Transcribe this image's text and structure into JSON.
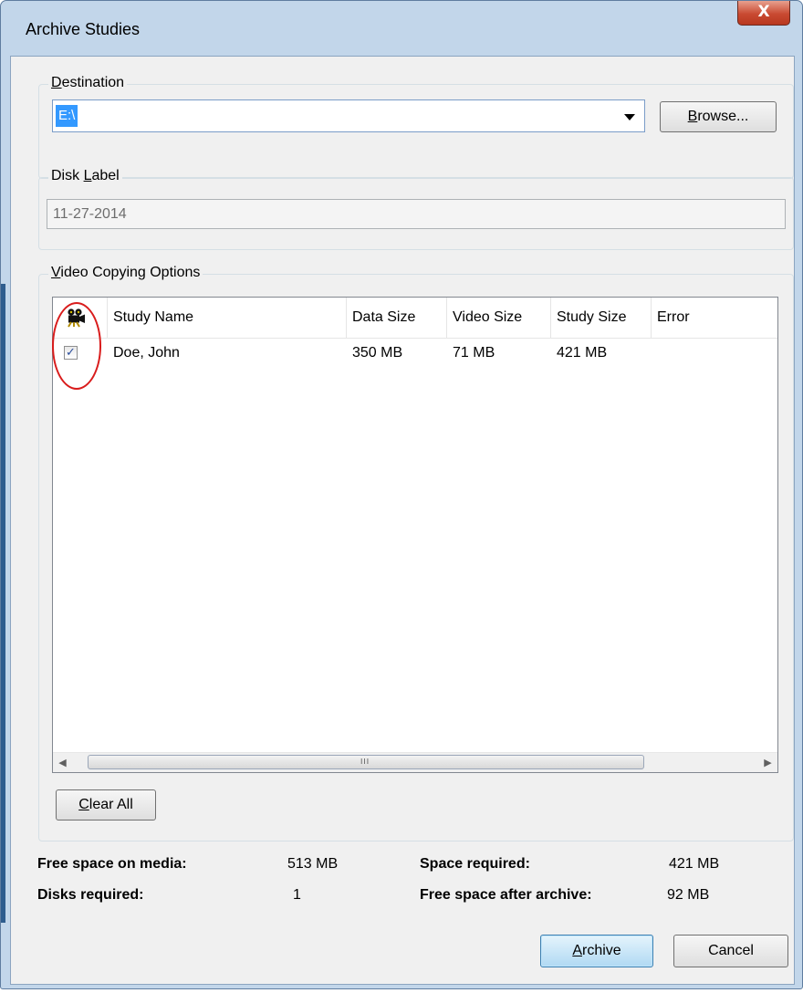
{
  "window": {
    "title": "Archive Studies",
    "close_glyph": "X"
  },
  "destination": {
    "label_prefix": "",
    "label_underlined": "D",
    "label_rest": "estination",
    "value": "E:\\",
    "browse_underlined": "B",
    "browse_rest": "rowse..."
  },
  "disk_label": {
    "label_prefix": "Disk ",
    "label_underlined": "L",
    "label_rest": "abel",
    "value": "11-27-2014"
  },
  "video_options": {
    "label_underlined": "V",
    "label_rest": "ideo Copying Options",
    "columns": [
      "Study Name",
      "Data Size",
      "Video Size",
      "Study Size",
      "Error"
    ],
    "header_icon": "camera-icon",
    "rows": [
      {
        "checked": true,
        "check_glyph": "✓",
        "study_name": "Doe, John",
        "data_size": "350 MB",
        "video_size": "71 MB",
        "study_size": "421 MB",
        "error": ""
      }
    ],
    "scroll_left": "◀",
    "scroll_right": "▶",
    "scroll_grip": "III",
    "clear_underlined": "C",
    "clear_rest": "lear All"
  },
  "summary": {
    "free_space_label": "Free space on media:",
    "free_space_value": "513 MB",
    "disks_label": "Disks required:",
    "disks_value": "1",
    "space_required_label": "Space required:",
    "space_required_value": "421 MB",
    "free_after_label": "Free space after archive:",
    "free_after_value": "92 MB"
  },
  "buttons": {
    "archive_underlined": "A",
    "archive_rest": "rchive",
    "cancel": "Cancel"
  },
  "colors": {
    "annotation": "#d91c1c",
    "selection": "#3399ff"
  }
}
